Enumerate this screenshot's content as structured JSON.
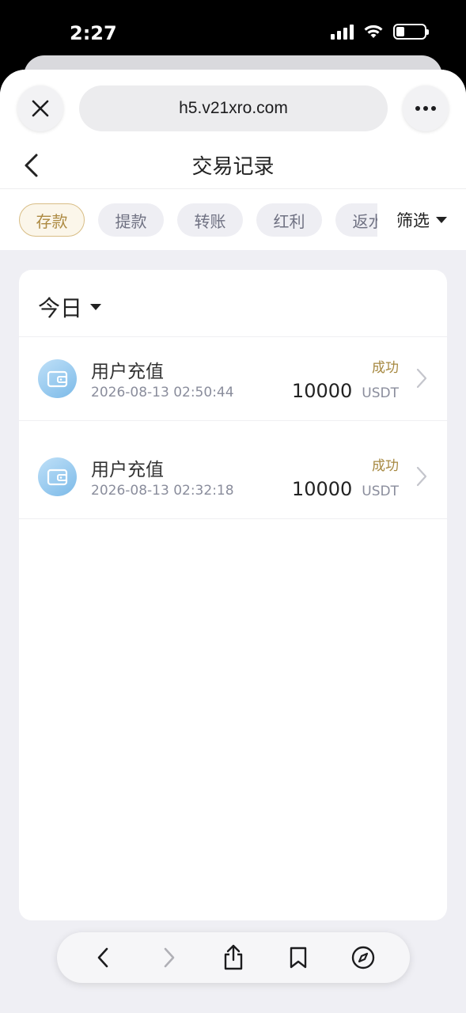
{
  "status_bar": {
    "time": "2:27",
    "battery_level": 0.3
  },
  "browser": {
    "url": "h5.v21xro.com"
  },
  "page": {
    "title": "交易记录"
  },
  "tabs": [
    {
      "label": "存款",
      "active": true
    },
    {
      "label": "提款",
      "active": false
    },
    {
      "label": "转账",
      "active": false
    },
    {
      "label": "红利",
      "active": false
    },
    {
      "label": "返水",
      "active": false
    }
  ],
  "filter": {
    "label": "筛选"
  },
  "section": {
    "date_label": "今日"
  },
  "transactions": [
    {
      "title": "用户充值",
      "time": "2026-08-13 02:50:44",
      "status": "成功",
      "amount": "10000",
      "unit": "USDT",
      "icon": "wallet-icon"
    },
    {
      "title": "用户充值",
      "time": "2026-08-13 02:32:18",
      "status": "成功",
      "amount": "10000",
      "unit": "USDT",
      "icon": "wallet-icon"
    }
  ],
  "colors": {
    "accent": "#ad8a42",
    "status_success": "#a68840",
    "sheet_bg": "#efeff4"
  },
  "toolbar_icons": [
    "back-icon",
    "forward-icon",
    "share-icon",
    "bookmarks-icon",
    "compass-icon"
  ]
}
